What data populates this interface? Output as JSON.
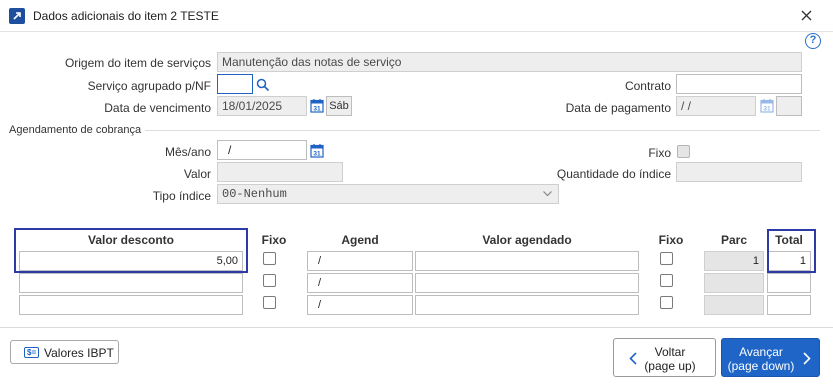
{
  "window": {
    "title": "Dados adicionais do item 2 TESTE"
  },
  "help": {
    "label": "?"
  },
  "form": {
    "origem_label": "Origem do item de serviços",
    "origem_value": "Manutenção das notas de serviço",
    "servico_label": "Serviço agrupado p/NF",
    "servico_value": "",
    "contrato_label": "Contrato",
    "contrato_value": "",
    "vencimento_label": "Data de vencimento",
    "vencimento_value": "18/01/2025",
    "vencimento_day": "Sáb",
    "pagamento_label": "Data de pagamento",
    "pagamento_value": "/  /",
    "pagamento_day": ""
  },
  "agendamento": {
    "section_title": "Agendamento de cobrança",
    "mesano_label": "Mês/ano",
    "mesano_value": "/",
    "fixo_label": "Fixo",
    "valor_label": "Valor",
    "valor_value": "",
    "qtd_label": "Quantidade do índice",
    "qtd_value": "",
    "tipo_label": "Tipo índice",
    "tipo_value": "00-Nenhum"
  },
  "table": {
    "headers": {
      "valor_desconto": "Valor desconto",
      "fixo": "Fixo",
      "agend": "Agend",
      "valor_agendado": "Valor agendado",
      "fixo2": "Fixo",
      "parc": "Parc",
      "total": "Total"
    },
    "rows": [
      {
        "valor_desconto": "5,00",
        "agend": "/",
        "valor_agendado": "",
        "parc": "1",
        "total": "1"
      },
      {
        "valor_desconto": "",
        "agend": "/",
        "valor_agendado": "",
        "parc": "",
        "total": ""
      },
      {
        "valor_desconto": "",
        "agend": "/",
        "valor_agendado": "",
        "parc": "",
        "total": ""
      }
    ]
  },
  "footer": {
    "ibpt_label": "Valores IBPT",
    "ibpt_icon_text": "$=",
    "back_line1": "Voltar",
    "back_line2": "(page up)",
    "next_line1": "Avançar",
    "next_line2": "(page down)"
  },
  "colors": {
    "accent": "#1f65c8",
    "highlight": "#2e3ba6"
  }
}
